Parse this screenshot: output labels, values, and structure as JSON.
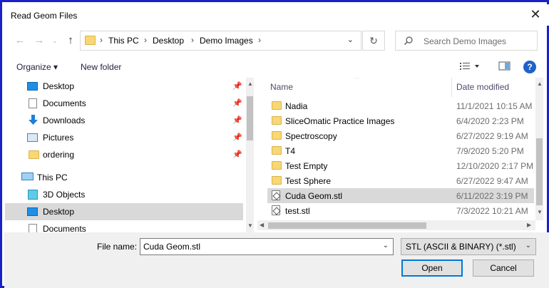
{
  "window": {
    "title": "Read Geom Files",
    "close_glyph": "✕"
  },
  "address": {
    "crumbs": [
      "This PC",
      "Desktop",
      "Demo Images"
    ],
    "search_placeholder": "Search Demo Images"
  },
  "toolbar": {
    "organize": "Organize ▾",
    "new_folder": "New folder"
  },
  "sidebar": {
    "items": [
      {
        "label": "Desktop",
        "icon": "desktop-icon",
        "pinned": true
      },
      {
        "label": "Documents",
        "icon": "documents-icon",
        "pinned": true
      },
      {
        "label": "Downloads",
        "icon": "downloads-icon",
        "pinned": true
      },
      {
        "label": "Pictures",
        "icon": "pictures-icon",
        "pinned": true
      },
      {
        "label": "ordering",
        "icon": "folder-icon",
        "pinned": true
      },
      {
        "label": "This PC",
        "icon": "this-pc-icon",
        "pinned": false
      },
      {
        "label": "3D Objects",
        "icon": "3d-objects-icon",
        "pinned": false
      },
      {
        "label": "Desktop",
        "icon": "desktop-icon",
        "pinned": false,
        "selected": true
      },
      {
        "label": "Documents",
        "icon": "documents-icon",
        "pinned": false
      }
    ]
  },
  "files": {
    "columns": {
      "name": "Name",
      "date": "Date modified"
    },
    "rows": [
      {
        "name": "Nadia",
        "date": "11/1/2021 10:15 AM",
        "type": "folder"
      },
      {
        "name": "SliceOmatic Practice Images",
        "date": "6/4/2020 2:23 PM",
        "type": "folder"
      },
      {
        "name": "Spectroscopy",
        "date": "6/27/2022 9:19 AM",
        "type": "folder"
      },
      {
        "name": "T4",
        "date": "7/9/2020 5:20 PM",
        "type": "folder"
      },
      {
        "name": "Test Empty",
        "date": "12/10/2020 2:17 PM",
        "type": "folder"
      },
      {
        "name": "Test Sphere",
        "date": "6/27/2022 9:47 AM",
        "type": "folder"
      },
      {
        "name": "Cuda Geom.stl",
        "date": "6/11/2022 3:19 PM",
        "type": "stl",
        "selected": true
      },
      {
        "name": "test.stl",
        "date": "7/3/2022 10:21 AM",
        "type": "stl"
      }
    ]
  },
  "footer": {
    "file_name_label": "File name:",
    "file_name_value": "Cuda Geom.stl",
    "file_type": "STL (ASCII & BINARY) (*.stl)",
    "open_label": "Open",
    "cancel_label": "Cancel"
  },
  "colors": {
    "border": "#1a21c8",
    "selection": "#d9d9d9",
    "folder": "#f8d775",
    "accent": "#0078d7"
  }
}
